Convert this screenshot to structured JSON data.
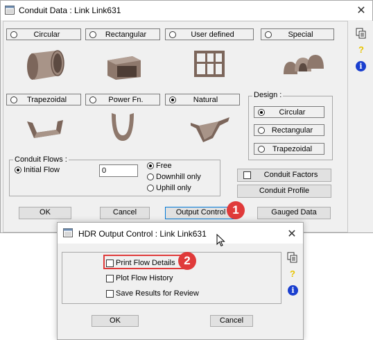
{
  "main_dialog": {
    "title": "Conduit Data : Link Link631",
    "close_symbol": "✕",
    "shapes": [
      {
        "label": "Circular",
        "selected": false
      },
      {
        "label": "Rectangular",
        "selected": false
      },
      {
        "label": "User defined",
        "selected": false
      },
      {
        "label": "Special",
        "selected": false
      },
      {
        "label": "Trapezoidal",
        "selected": false
      },
      {
        "label": "Power Fn.",
        "selected": false
      },
      {
        "label": "Natural",
        "selected": true
      }
    ],
    "design": {
      "legend": "Design :",
      "options": [
        {
          "label": "Circular",
          "selected": true
        },
        {
          "label": "Rectangular",
          "selected": false
        },
        {
          "label": "Trapezoidal",
          "selected": false
        }
      ]
    },
    "conduit_flows": {
      "legend": "Conduit Flows :",
      "initial_flow_label": "Initial Flow",
      "initial_flow_value": "0",
      "flow_options": [
        {
          "label": "Free",
          "selected": true
        },
        {
          "label": "Downhill only",
          "selected": false
        },
        {
          "label": "Uphill only",
          "selected": false
        }
      ]
    },
    "conduit_factors_label": "Conduit Factors",
    "conduit_profile_label": "Conduit Profile",
    "buttons": {
      "ok": "OK",
      "cancel": "Cancel",
      "output_control": "Output Control",
      "gauged_data": "Gauged Data"
    },
    "side_icons": [
      "copy-icon",
      "help-icon",
      "info-icon"
    ]
  },
  "output_dialog": {
    "title": "HDR Output Control : Link Link631",
    "close_symbol": "✕",
    "options": [
      {
        "label": "Print Flow Details",
        "checked": false
      },
      {
        "label": "Plot Flow History",
        "checked": false
      },
      {
        "label": "Save Results for Review",
        "checked": false
      }
    ],
    "buttons": {
      "ok": "OK",
      "cancel": "Cancel"
    },
    "side_icons": [
      "copy-icon",
      "help-icon",
      "info-icon"
    ]
  },
  "markers": [
    "1",
    "2"
  ],
  "colors": {
    "marker_fill": "#e03a3a",
    "highlight_border": "#e03a3a",
    "dialog_bg": "#f0f0f0",
    "shape_fill": "#8a7468",
    "info_blue": "#1a3fcf",
    "help_yellow": "#e8c400"
  }
}
